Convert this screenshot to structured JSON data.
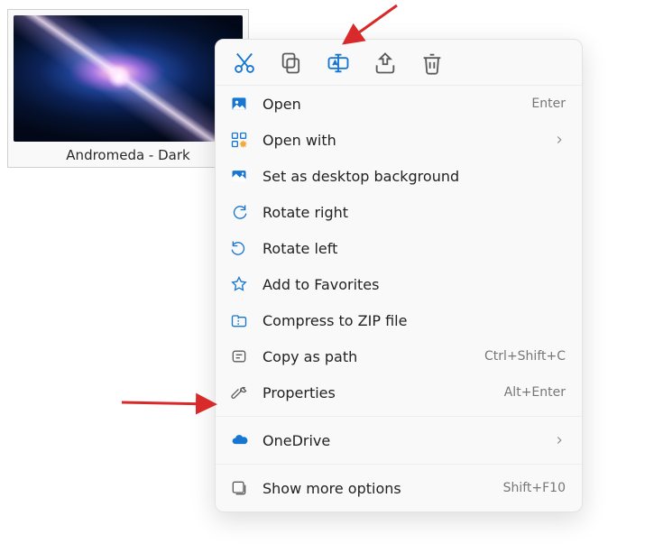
{
  "file": {
    "label": "Andromeda - Dark"
  },
  "actionbar": {
    "icons": [
      "cut",
      "copy",
      "rename",
      "share",
      "delete"
    ]
  },
  "menu": {
    "open": {
      "label": "Open",
      "shortcut": "Enter"
    },
    "open_with": {
      "label": "Open with"
    },
    "set_bg": {
      "label": "Set as desktop background"
    },
    "rotate_right": {
      "label": "Rotate right"
    },
    "rotate_left": {
      "label": "Rotate left"
    },
    "add_favorites": {
      "label": "Add to Favorites"
    },
    "compress_zip": {
      "label": "Compress to ZIP file"
    },
    "copy_path": {
      "label": "Copy as path",
      "shortcut": "Ctrl+Shift+C"
    },
    "properties": {
      "label": "Properties",
      "shortcut": "Alt+Enter"
    },
    "onedrive": {
      "label": "OneDrive"
    },
    "show_more": {
      "label": "Show more options",
      "shortcut": "Shift+F10"
    }
  }
}
